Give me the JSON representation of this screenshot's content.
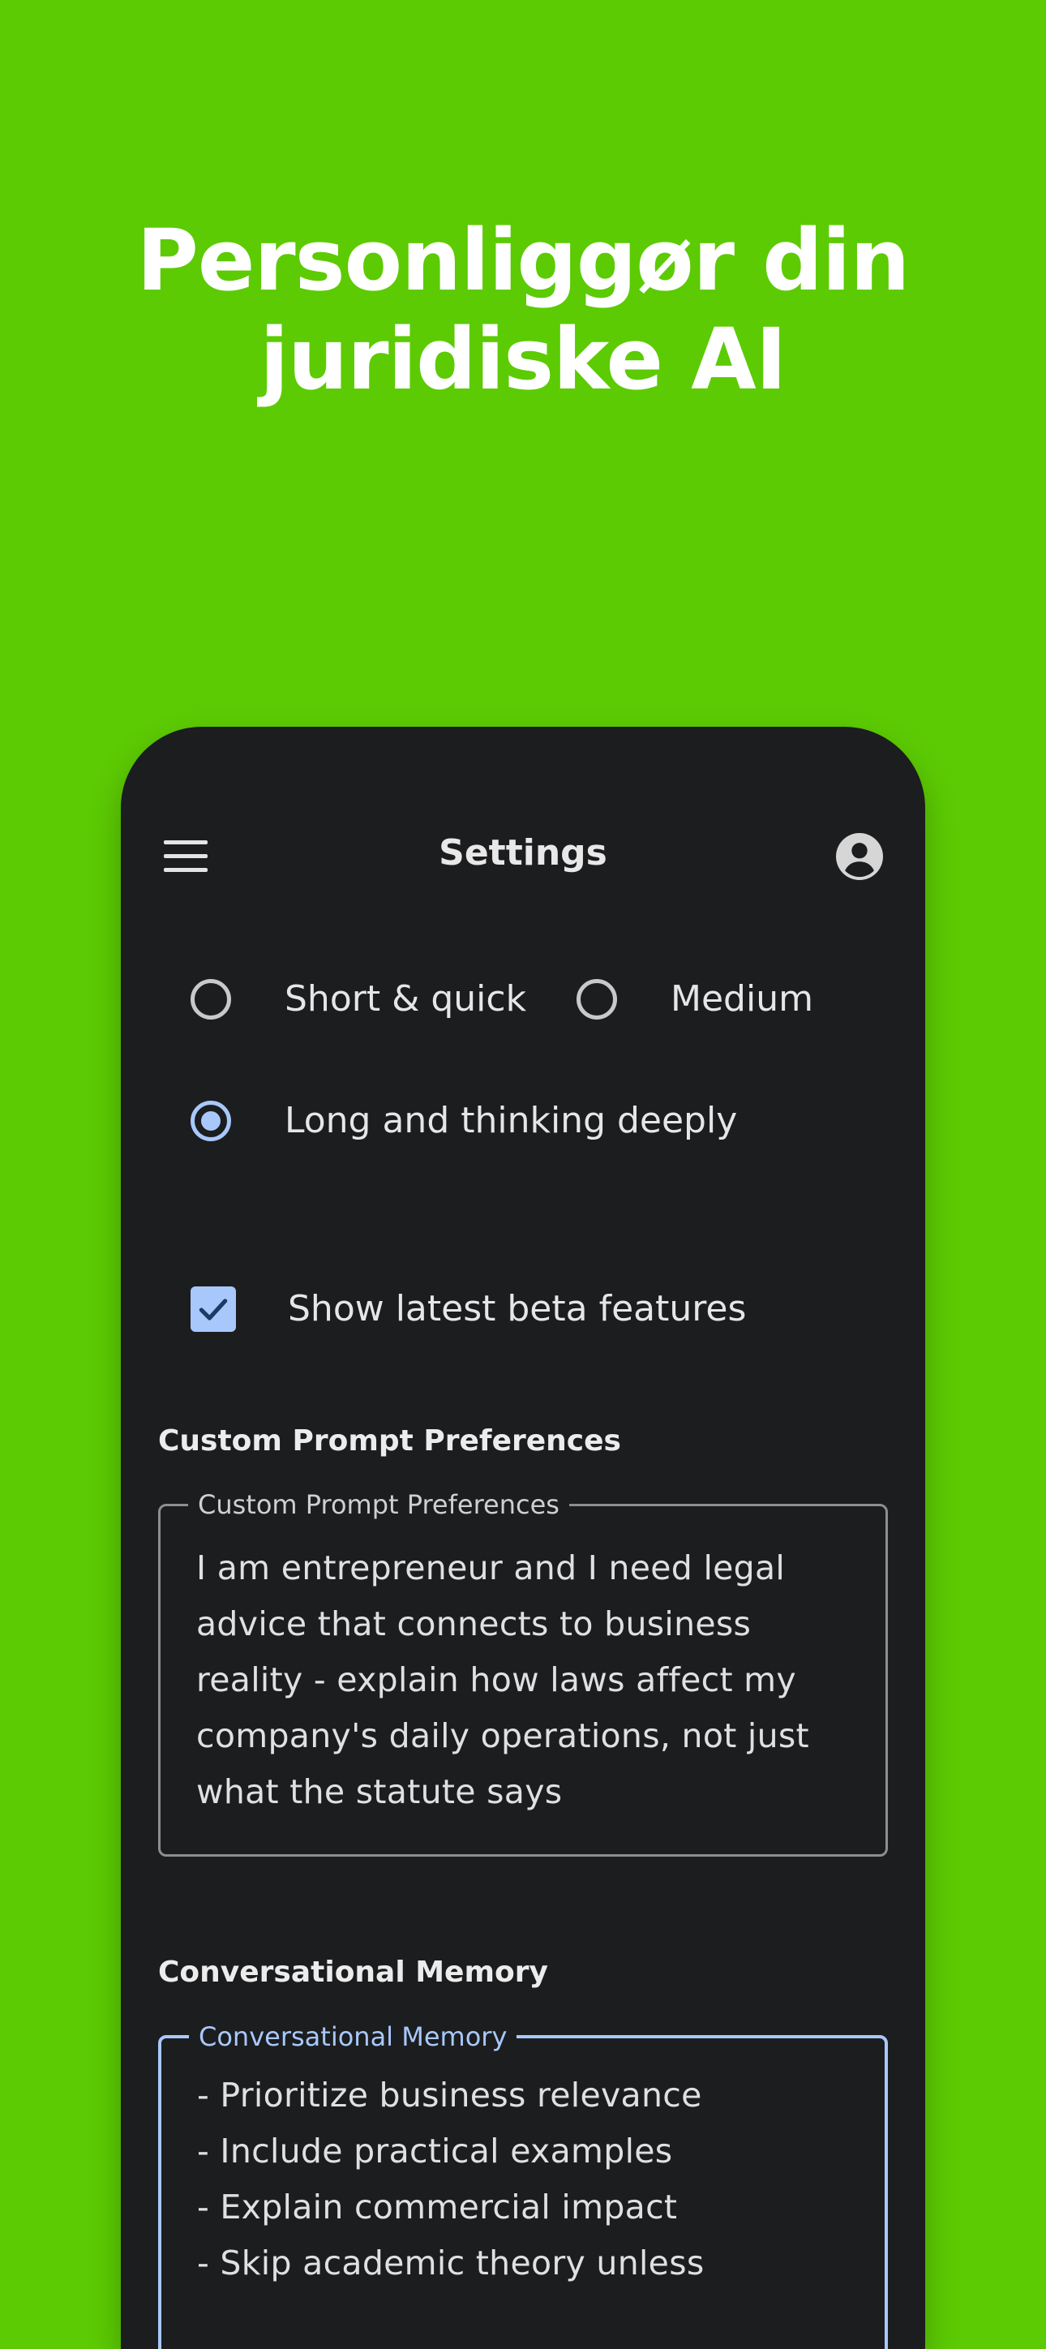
{
  "headline": {
    "line1": "Personliggør din",
    "line2": "juridiske AI"
  },
  "appbar": {
    "title": "Settings",
    "menu_icon": "hamburger-menu-icon",
    "account_icon": "account-circle-icon"
  },
  "response_length": {
    "options": [
      {
        "label": "Short & quick",
        "selected": false
      },
      {
        "label": "Medium",
        "selected": false
      },
      {
        "label": "Long and thinking deeply",
        "selected": true
      }
    ]
  },
  "beta": {
    "label": "Show latest beta features",
    "checked": true
  },
  "custom_prompt": {
    "section_title": "Custom Prompt Preferences",
    "field_label": "Custom Prompt Preferences",
    "value": "I am entrepreneur and I  need legal\nadvice that connects to business\nreality - explain how laws affect my\ncompany's daily operations, not just\nwhat the statute says"
  },
  "memory": {
    "section_title": "Conversational Memory",
    "field_label": "Conversational Memory",
    "value": "- Prioritize business relevance\n- Include practical examples\n- Explain commercial impact\n- Skip academic theory unless"
  },
  "colors": {
    "background": "#5ccb03",
    "surface": "#1c1d1f",
    "accent": "#a8c8fb"
  }
}
